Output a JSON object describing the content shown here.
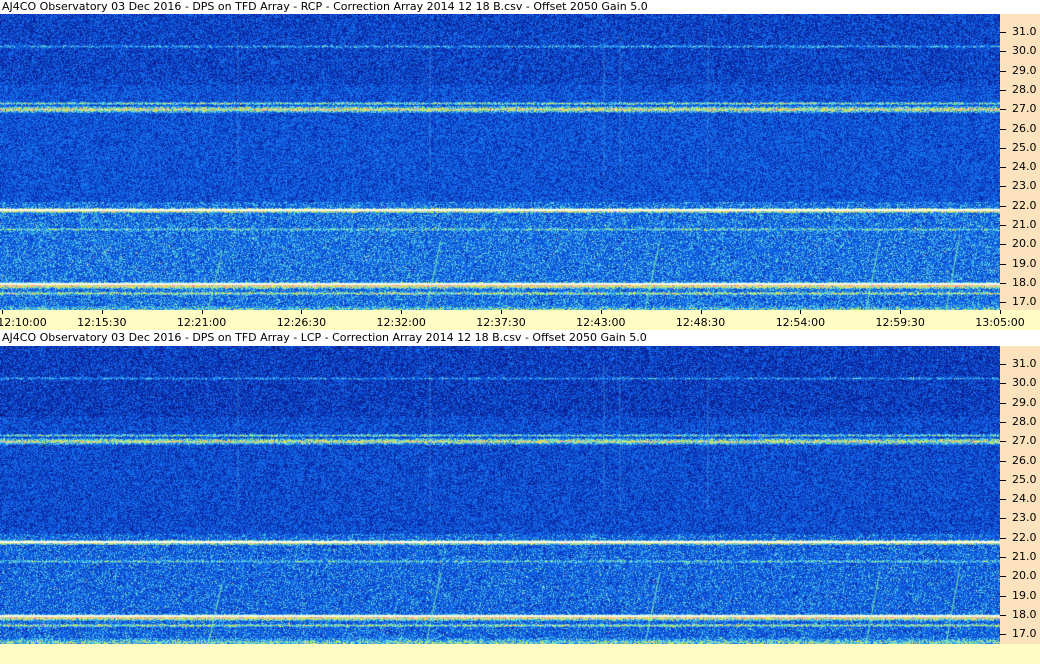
{
  "panels": [
    {
      "title": "AJ4CO Observatory 03 Dec 2016  -  DPS on TFD Array  -  RCP  -  Correction Array 2014 12 18 B.csv  -  Offset 2050  Gain 5.0",
      "polarization": "RCP"
    },
    {
      "title": "AJ4CO Observatory 03 Dec 2016  -  DPS on TFD Array  -  LCP  -  Correction Array 2014 12 18 B.csv  -  Offset 2050  Gain 5.0",
      "polarization": "LCP"
    }
  ],
  "frequency_axis": {
    "labels": [
      "31.0",
      "30.0",
      "29.0",
      "28.0",
      "27.0",
      "26.0",
      "25.0",
      "24.0",
      "23.0",
      "22.0",
      "21.0",
      "20.0",
      "19.0",
      "18.0",
      "17.0"
    ],
    "values": [
      31,
      30,
      29,
      28,
      27,
      26,
      25,
      24,
      23,
      22,
      21,
      20,
      19,
      18,
      17
    ]
  },
  "time_axis": {
    "labels": [
      "12:10:00",
      "12:15:30",
      "12:21:00",
      "12:26:30",
      "12:32:00",
      "12:37:30",
      "12:43:00",
      "12:48:30",
      "12:54:00",
      "12:59:30",
      "13:05:00"
    ]
  },
  "colors": {
    "spectrogram_base": "#1a4fd6",
    "freq_axis_bg": "#fde3bd",
    "time_axis_bg": "#fffcc4"
  }
}
